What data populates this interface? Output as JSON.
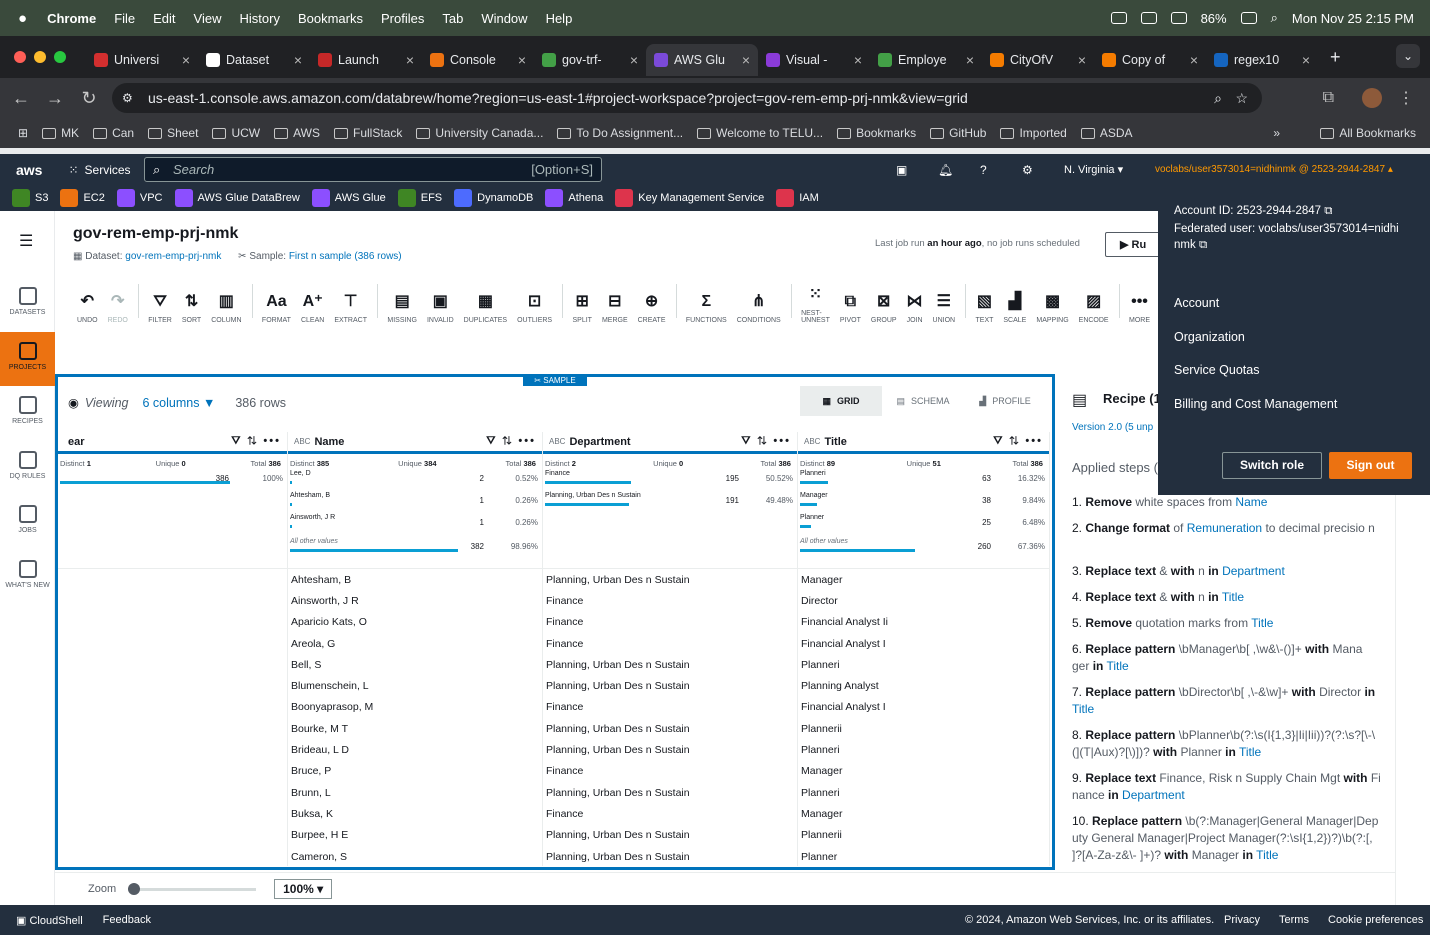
{
  "macos": {
    "menus": [
      "Chrome",
      "File",
      "Edit",
      "View",
      "History",
      "Bookmarks",
      "Profiles",
      "Tab",
      "Window",
      "Help"
    ],
    "battery": "86%",
    "datetime": "Mon Nov 25  2:15 PM"
  },
  "browser": {
    "tabs": [
      {
        "label": "Universi",
        "color": "#d32f2f"
      },
      {
        "label": "Dataset",
        "color": "#fff"
      },
      {
        "label": "Launch",
        "color": "#c62828"
      },
      {
        "label": "Console",
        "color": "#ec7211"
      },
      {
        "label": "gov-trf-",
        "color": "#43a047"
      },
      {
        "label": "AWS Glu",
        "color": "#7b4ad9"
      },
      {
        "label": "Visual -",
        "color": "#8b3bd9"
      },
      {
        "label": "Employe",
        "color": "#43a047"
      },
      {
        "label": "CityOfV",
        "color": "#f57c00"
      },
      {
        "label": "Copy of",
        "color": "#f57c00"
      },
      {
        "label": "regex10",
        "color": "#1565c0"
      }
    ],
    "url": "us-east-1.console.aws.amazon.com/databrew/home?region=us-east-1#project-workspace?project=gov-rem-emp-prj-nmk&view=grid",
    "bookmarks": [
      "MK",
      "Can",
      "Sheet",
      "UCW",
      "AWS",
      "FullStack",
      "University Canada...",
      "To Do Assignment...",
      "Welcome to TELU...",
      "Bookmarks",
      "GitHub",
      "Imported",
      "ASDA"
    ],
    "all_bookmarks": "All Bookmarks"
  },
  "aws": {
    "services_label": "Services",
    "search_placeholder": "Search",
    "search_shortcut": "[Option+S]",
    "region": "N. Virginia",
    "account_label": "voclabs/user3573014=nidhinmk @ 2523-2944-2847",
    "favorites": [
      {
        "label": "S3",
        "color": "#3f8624"
      },
      {
        "label": "EC2",
        "color": "#ec7211"
      },
      {
        "label": "VPC",
        "color": "#8c4fff"
      },
      {
        "label": "AWS Glue DataBrew",
        "color": "#8c4fff"
      },
      {
        "label": "AWS Glue",
        "color": "#8c4fff"
      },
      {
        "label": "EFS",
        "color": "#3f8624"
      },
      {
        "label": "DynamoDB",
        "color": "#4d6bfe"
      },
      {
        "label": "Athena",
        "color": "#8c4fff"
      },
      {
        "label": "Key Management Service",
        "color": "#dd344c"
      },
      {
        "label": "IAM",
        "color": "#dd344c"
      }
    ]
  },
  "sidebar": [
    {
      "label": "DATASETS",
      "active": false
    },
    {
      "label": "PROJECTS",
      "active": true
    },
    {
      "label": "RECIPES",
      "active": false
    },
    {
      "label": "DQ RULES",
      "active": false
    },
    {
      "label": "JOBS",
      "active": false
    },
    {
      "label": "WHAT'S NEW",
      "active": false
    }
  ],
  "project": {
    "title": "gov-rem-emp-prj-nmk",
    "dataset_label": "Dataset:",
    "dataset": "gov-rem-emp-prj-nmk",
    "sample_label": "Sample:",
    "sample": "First n sample (386 rows)",
    "last_job_prefix": "Last job run",
    "last_job_time": "an hour ago",
    "last_job_suffix": ", no job runs scheduled",
    "run_label": "Ru"
  },
  "toolbar": [
    {
      "label": "UNDO",
      "icon": "↶"
    },
    {
      "label": "REDO",
      "icon": "↷",
      "disabled": true
    },
    {
      "sep": true
    },
    {
      "label": "FILTER",
      "icon": "⛛"
    },
    {
      "label": "SORT",
      "icon": "⇅"
    },
    {
      "label": "COLUMN",
      "icon": "▥"
    },
    {
      "sep": true
    },
    {
      "label": "FORMAT",
      "icon": "Aa"
    },
    {
      "label": "CLEAN",
      "icon": "A⁺"
    },
    {
      "label": "EXTRACT",
      "icon": "⊤"
    },
    {
      "sep": true
    },
    {
      "label": "MISSING",
      "icon": "▤"
    },
    {
      "label": "INVALID",
      "icon": "▣"
    },
    {
      "label": "DUPLICATES",
      "icon": "▦"
    },
    {
      "label": "OUTLIERS",
      "icon": "⊡"
    },
    {
      "sep": true
    },
    {
      "label": "SPLIT",
      "icon": "⊞"
    },
    {
      "label": "MERGE",
      "icon": "⊟"
    },
    {
      "label": "CREATE",
      "icon": "⊕"
    },
    {
      "sep": true
    },
    {
      "label": "FUNCTIONS",
      "icon": "Σ"
    },
    {
      "label": "CONDITIONS",
      "icon": "⋔"
    },
    {
      "sep": true
    },
    {
      "label": "NEST-UNNEST",
      "icon": "⁙"
    },
    {
      "label": "PIVOT",
      "icon": "⧉"
    },
    {
      "label": "GROUP",
      "icon": "⊠"
    },
    {
      "label": "JOIN",
      "icon": "⋈"
    },
    {
      "label": "UNION",
      "icon": "☰"
    },
    {
      "sep": true
    },
    {
      "label": "TEXT",
      "icon": "▧"
    },
    {
      "label": "SCALE",
      "icon": "▟"
    },
    {
      "label": "MAPPING",
      "icon": "▩"
    },
    {
      "label": "ENCODE",
      "icon": "▨"
    },
    {
      "sep": true
    },
    {
      "label": "MORE",
      "icon": "•••"
    }
  ],
  "grid": {
    "sample_badge": "SAMPLE",
    "viewing_label": "Viewing",
    "columns_label": "6 columns",
    "rows_label": "386 rows",
    "views": [
      "GRID",
      "SCHEMA",
      "PROFILE"
    ],
    "distinct_label": "Distinct",
    "unique_label": "Unique",
    "total_label": "Total",
    "columns": [
      {
        "name": "ear",
        "type": "",
        "distinct": "1",
        "unique": "0",
        "total": "386",
        "top": [
          {
            "label": "",
            "count": "386",
            "pct": "100%",
            "frac": 1.0
          }
        ],
        "other": null
      },
      {
        "name": "Name",
        "type": "ABC",
        "distinct": "385",
        "unique": "384",
        "total": "386",
        "top": [
          {
            "label": "Lee, D",
            "count": "2",
            "pct": "0.52%",
            "frac": 0.01
          },
          {
            "label": "Ahtesham, B",
            "count": "1",
            "pct": "0.26%",
            "frac": 0.005
          },
          {
            "label": "Ainsworth, J R",
            "count": "1",
            "pct": "0.26%",
            "frac": 0.005
          }
        ],
        "other": {
          "label": "All other values",
          "count": "382",
          "pct": "98.96%",
          "frac": 0.99
        }
      },
      {
        "name": "Department",
        "type": "ABC",
        "distinct": "2",
        "unique": "0",
        "total": "386",
        "top": [
          {
            "label": "Finance",
            "count": "195",
            "pct": "50.52%",
            "frac": 0.505
          },
          {
            "label": "Planning, Urban Des n Sustain",
            "count": "191",
            "pct": "49.48%",
            "frac": 0.495
          }
        ],
        "other": null
      },
      {
        "name": "Title",
        "type": "ABC",
        "distinct": "89",
        "unique": "51",
        "total": "386",
        "top": [
          {
            "label": "Planneri",
            "count": "63",
            "pct": "16.32%",
            "frac": 0.163
          },
          {
            "label": "Manager",
            "count": "38",
            "pct": "9.84%",
            "frac": 0.098
          },
          {
            "label": "Planner",
            "count": "25",
            "pct": "6.48%",
            "frac": 0.065
          }
        ],
        "other": {
          "label": "All other values",
          "count": "260",
          "pct": "67.36%",
          "frac": 0.674
        }
      }
    ],
    "rows": [
      [
        "",
        "Ahtesham, B",
        "Planning, Urban Des n Sustain",
        "Manager"
      ],
      [
        "",
        "Ainsworth, J R",
        "Finance",
        "Director"
      ],
      [
        "",
        "Aparicio Kats, O",
        "Finance",
        "Financial Analyst Ii"
      ],
      [
        "",
        "Areola, G",
        "Finance",
        "Financial Analyst I"
      ],
      [
        "",
        "Bell, S",
        "Planning, Urban Des n Sustain",
        "Planneri"
      ],
      [
        "",
        "Blumenschein, L",
        "Planning, Urban Des n Sustain",
        "Planning Analyst"
      ],
      [
        "",
        "Boonyaprasop, M",
        "Finance",
        "Financial Analyst I"
      ],
      [
        "",
        "Bourke, M T",
        "Planning, Urban Des n Sustain",
        "Plannerii"
      ],
      [
        "",
        "Brideau, L D",
        "Planning, Urban Des n Sustain",
        "Planneri"
      ],
      [
        "",
        "Bruce, P",
        "Finance",
        "Manager"
      ],
      [
        "",
        "Brunn, L",
        "Planning, Urban Des n Sustain",
        "Planneri"
      ],
      [
        "",
        "Buksa, K",
        "Finance",
        "Manager"
      ],
      [
        "",
        "Burpee, H E",
        "Planning, Urban Des n Sustain",
        "Plannerii"
      ],
      [
        "",
        "Cameron, S",
        "Planning, Urban Des n Sustain",
        "Planner"
      ]
    ]
  },
  "recipe": {
    "title": "Recipe (1",
    "version": "Version 2.0 (5 unp",
    "applied_label": "Applied steps (",
    "steps": [
      {
        "n": "1.",
        "parts": [
          [
            "b",
            "Remove"
          ],
          [
            "g",
            " white spaces from "
          ],
          [
            "c",
            "Name"
          ]
        ]
      },
      {
        "n": "2.",
        "parts": [
          [
            "b",
            "Change format"
          ],
          [
            "g",
            " of "
          ],
          [
            "c",
            "Remuneration"
          ],
          [
            "g",
            " to "
          ],
          [
            "g",
            "decimal precisio n"
          ]
        ]
      },
      {
        "n": "3.",
        "parts": [
          [
            "b",
            "Replace text"
          ],
          [
            "g",
            " & "
          ],
          [
            "b",
            "with"
          ],
          [
            "g",
            "  n  "
          ],
          [
            "b",
            "in"
          ],
          [
            "c",
            " Department"
          ]
        ]
      },
      {
        "n": "4.",
        "parts": [
          [
            "b",
            "Replace text"
          ],
          [
            "g",
            " & "
          ],
          [
            "b",
            "with"
          ],
          [
            "g",
            "  n  "
          ],
          [
            "b",
            "in"
          ],
          [
            "c",
            " Title"
          ]
        ]
      },
      {
        "n": "5.",
        "parts": [
          [
            "b",
            "Remove"
          ],
          [
            "g",
            " quotation marks from "
          ],
          [
            "c",
            "Title"
          ]
        ]
      },
      {
        "n": "6.",
        "parts": [
          [
            "b",
            "Replace pattern"
          ],
          [
            "g",
            " \\bManager\\b[ ,\\w&\\-()]+ "
          ],
          [
            "b",
            "with"
          ],
          [
            "g",
            " Mana ger "
          ],
          [
            "b",
            "in"
          ],
          [
            "c",
            " Title"
          ]
        ]
      },
      {
        "n": "7.",
        "parts": [
          [
            "b",
            "Replace pattern"
          ],
          [
            "g",
            " \\bDirector\\b[ ,\\-&\\w]+ "
          ],
          [
            "b",
            "with"
          ],
          [
            "g",
            " Director "
          ],
          [
            "b",
            "in"
          ],
          [
            "c",
            " Title"
          ]
        ]
      },
      {
        "n": "8.",
        "parts": [
          [
            "b",
            "Replace pattern"
          ],
          [
            "g",
            " \\bPlanner\\b(?:\\s(I{1,3}|Ii|Iii))?(?:\\s?[\\-\\(](T|Aux)?[\\)])? "
          ],
          [
            "b",
            "with"
          ],
          [
            "g",
            " Planner "
          ],
          [
            "b",
            "in"
          ],
          [
            "c",
            " Title"
          ]
        ]
      },
      {
        "n": "9.",
        "parts": [
          [
            "b",
            "Replace text"
          ],
          [
            "g",
            " Finance, Risk n Supply Chain Mgt "
          ],
          [
            "b",
            "with"
          ],
          [
            "g",
            " Fi nance "
          ],
          [
            "b",
            "in"
          ],
          [
            "c",
            " Department"
          ]
        ]
      },
      {
        "n": "10.",
        "parts": [
          [
            "b",
            "Replace pattern"
          ],
          [
            "g",
            " \\b(?:Manager|General Manager|Dep uty General Manager|Project Manager(?:\\sI{1,2})?)\\b(?:[, ]?[A-Za-z&\\- ]+)? "
          ],
          [
            "b",
            "with"
          ],
          [
            "g",
            " Manager "
          ],
          [
            "b",
            "in"
          ],
          [
            "c",
            " Title"
          ]
        ]
      }
    ]
  },
  "account_menu": {
    "account_id": "Account ID: 2523-2944-2847",
    "federated": "Federated user: voclabs/user3573014=nidhi nmk",
    "items": [
      "Account",
      "Organization",
      "Service Quotas",
      "Billing and Cost Management"
    ],
    "switch_role": "Switch role",
    "sign_out": "Sign out"
  },
  "zoom": {
    "label": "Zoom",
    "value": "100%",
    "fraction": 0.0
  },
  "footer": {
    "cloudshell": "CloudShell",
    "feedback": "Feedback",
    "copyright": "© 2024, Amazon Web Services, Inc. or its affiliates.",
    "links": [
      "Privacy",
      "Terms",
      "Cookie preferences"
    ]
  },
  "colors": {
    "accent": "#0073bb",
    "orange": "#ec7211",
    "aws_dark": "#232f3e"
  }
}
